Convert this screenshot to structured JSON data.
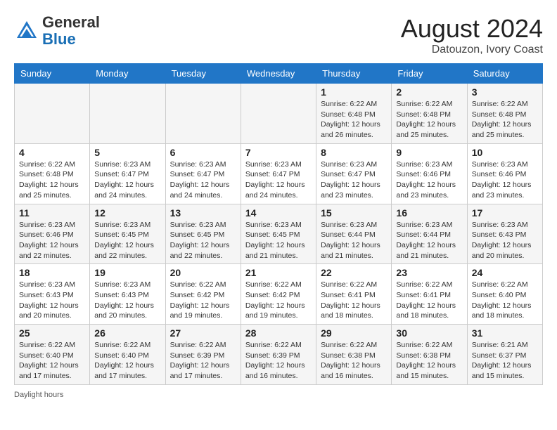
{
  "header": {
    "logo_line1": "General",
    "logo_line2": "Blue",
    "month_year": "August 2024",
    "location": "Datouzon, Ivory Coast"
  },
  "footer": {
    "daylight_label": "Daylight hours"
  },
  "days_of_week": [
    "Sunday",
    "Monday",
    "Tuesday",
    "Wednesday",
    "Thursday",
    "Friday",
    "Saturday"
  ],
  "weeks": [
    {
      "cells": [
        {
          "empty": true
        },
        {
          "empty": true
        },
        {
          "empty": true
        },
        {
          "empty": true
        },
        {
          "day": "1",
          "sunrise": "Sunrise: 6:22 AM",
          "sunset": "Sunset: 6:48 PM",
          "daylight": "Daylight: 12 hours and 26 minutes."
        },
        {
          "day": "2",
          "sunrise": "Sunrise: 6:22 AM",
          "sunset": "Sunset: 6:48 PM",
          "daylight": "Daylight: 12 hours and 25 minutes."
        },
        {
          "day": "3",
          "sunrise": "Sunrise: 6:22 AM",
          "sunset": "Sunset: 6:48 PM",
          "daylight": "Daylight: 12 hours and 25 minutes."
        }
      ]
    },
    {
      "cells": [
        {
          "day": "4",
          "sunrise": "Sunrise: 6:22 AM",
          "sunset": "Sunset: 6:48 PM",
          "daylight": "Daylight: 12 hours and 25 minutes."
        },
        {
          "day": "5",
          "sunrise": "Sunrise: 6:23 AM",
          "sunset": "Sunset: 6:47 PM",
          "daylight": "Daylight: 12 hours and 24 minutes."
        },
        {
          "day": "6",
          "sunrise": "Sunrise: 6:23 AM",
          "sunset": "Sunset: 6:47 PM",
          "daylight": "Daylight: 12 hours and 24 minutes."
        },
        {
          "day": "7",
          "sunrise": "Sunrise: 6:23 AM",
          "sunset": "Sunset: 6:47 PM",
          "daylight": "Daylight: 12 hours and 24 minutes."
        },
        {
          "day": "8",
          "sunrise": "Sunrise: 6:23 AM",
          "sunset": "Sunset: 6:47 PM",
          "daylight": "Daylight: 12 hours and 23 minutes."
        },
        {
          "day": "9",
          "sunrise": "Sunrise: 6:23 AM",
          "sunset": "Sunset: 6:46 PM",
          "daylight": "Daylight: 12 hours and 23 minutes."
        },
        {
          "day": "10",
          "sunrise": "Sunrise: 6:23 AM",
          "sunset": "Sunset: 6:46 PM",
          "daylight": "Daylight: 12 hours and 23 minutes."
        }
      ]
    },
    {
      "cells": [
        {
          "day": "11",
          "sunrise": "Sunrise: 6:23 AM",
          "sunset": "Sunset: 6:46 PM",
          "daylight": "Daylight: 12 hours and 22 minutes."
        },
        {
          "day": "12",
          "sunrise": "Sunrise: 6:23 AM",
          "sunset": "Sunset: 6:45 PM",
          "daylight": "Daylight: 12 hours and 22 minutes."
        },
        {
          "day": "13",
          "sunrise": "Sunrise: 6:23 AM",
          "sunset": "Sunset: 6:45 PM",
          "daylight": "Daylight: 12 hours and 22 minutes."
        },
        {
          "day": "14",
          "sunrise": "Sunrise: 6:23 AM",
          "sunset": "Sunset: 6:45 PM",
          "daylight": "Daylight: 12 hours and 21 minutes."
        },
        {
          "day": "15",
          "sunrise": "Sunrise: 6:23 AM",
          "sunset": "Sunset: 6:44 PM",
          "daylight": "Daylight: 12 hours and 21 minutes."
        },
        {
          "day": "16",
          "sunrise": "Sunrise: 6:23 AM",
          "sunset": "Sunset: 6:44 PM",
          "daylight": "Daylight: 12 hours and 21 minutes."
        },
        {
          "day": "17",
          "sunrise": "Sunrise: 6:23 AM",
          "sunset": "Sunset: 6:43 PM",
          "daylight": "Daylight: 12 hours and 20 minutes."
        }
      ]
    },
    {
      "cells": [
        {
          "day": "18",
          "sunrise": "Sunrise: 6:23 AM",
          "sunset": "Sunset: 6:43 PM",
          "daylight": "Daylight: 12 hours and 20 minutes."
        },
        {
          "day": "19",
          "sunrise": "Sunrise: 6:23 AM",
          "sunset": "Sunset: 6:43 PM",
          "daylight": "Daylight: 12 hours and 20 minutes."
        },
        {
          "day": "20",
          "sunrise": "Sunrise: 6:22 AM",
          "sunset": "Sunset: 6:42 PM",
          "daylight": "Daylight: 12 hours and 19 minutes."
        },
        {
          "day": "21",
          "sunrise": "Sunrise: 6:22 AM",
          "sunset": "Sunset: 6:42 PM",
          "daylight": "Daylight: 12 hours and 19 minutes."
        },
        {
          "day": "22",
          "sunrise": "Sunrise: 6:22 AM",
          "sunset": "Sunset: 6:41 PM",
          "daylight": "Daylight: 12 hours and 18 minutes."
        },
        {
          "day": "23",
          "sunrise": "Sunrise: 6:22 AM",
          "sunset": "Sunset: 6:41 PM",
          "daylight": "Daylight: 12 hours and 18 minutes."
        },
        {
          "day": "24",
          "sunrise": "Sunrise: 6:22 AM",
          "sunset": "Sunset: 6:40 PM",
          "daylight": "Daylight: 12 hours and 18 minutes."
        }
      ]
    },
    {
      "cells": [
        {
          "day": "25",
          "sunrise": "Sunrise: 6:22 AM",
          "sunset": "Sunset: 6:40 PM",
          "daylight": "Daylight: 12 hours and 17 minutes."
        },
        {
          "day": "26",
          "sunrise": "Sunrise: 6:22 AM",
          "sunset": "Sunset: 6:40 PM",
          "daylight": "Daylight: 12 hours and 17 minutes."
        },
        {
          "day": "27",
          "sunrise": "Sunrise: 6:22 AM",
          "sunset": "Sunset: 6:39 PM",
          "daylight": "Daylight: 12 hours and 17 minutes."
        },
        {
          "day": "28",
          "sunrise": "Sunrise: 6:22 AM",
          "sunset": "Sunset: 6:39 PM",
          "daylight": "Daylight: 12 hours and 16 minutes."
        },
        {
          "day": "29",
          "sunrise": "Sunrise: 6:22 AM",
          "sunset": "Sunset: 6:38 PM",
          "daylight": "Daylight: 12 hours and 16 minutes."
        },
        {
          "day": "30",
          "sunrise": "Sunrise: 6:22 AM",
          "sunset": "Sunset: 6:38 PM",
          "daylight": "Daylight: 12 hours and 15 minutes."
        },
        {
          "day": "31",
          "sunrise": "Sunrise: 6:21 AM",
          "sunset": "Sunset: 6:37 PM",
          "daylight": "Daylight: 12 hours and 15 minutes."
        }
      ]
    }
  ]
}
